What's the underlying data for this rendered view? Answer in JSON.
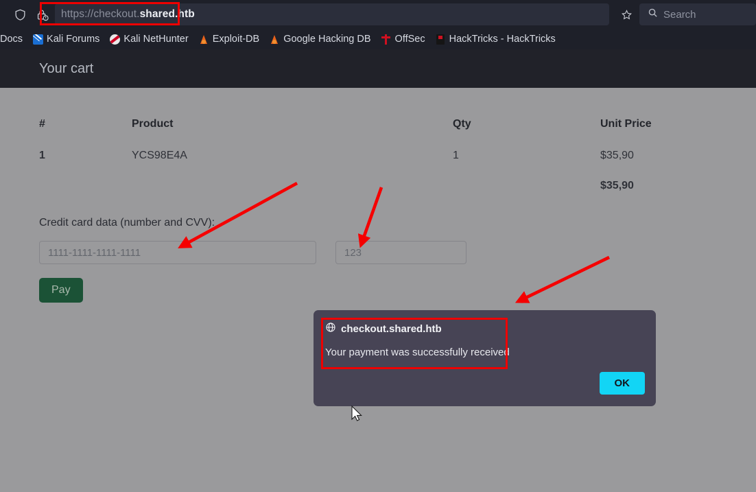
{
  "browser": {
    "url_prefix": "https://checkout.",
    "url_domain": "shared.htb",
    "shield_icon": "shield-icon",
    "lock_icon": "lock-warning-icon",
    "bookmark_star_icon": "star-icon",
    "search": {
      "placeholder": "Search",
      "icon": "search-icon"
    },
    "bookmarks": [
      {
        "label": "Docs",
        "icon": "none"
      },
      {
        "label": "Kali Forums",
        "icon": "kali-dragon-icon"
      },
      {
        "label": "Kali NetHunter",
        "icon": "nethunter-icon"
      },
      {
        "label": "Exploit-DB",
        "icon": "flame-icon"
      },
      {
        "label": "Google Hacking DB",
        "icon": "flame-icon"
      },
      {
        "label": "OffSec",
        "icon": "offsec-dagger-icon"
      },
      {
        "label": "HackTricks - HackTricks",
        "icon": "hacktricks-book-icon"
      }
    ]
  },
  "page": {
    "site_title": "Your cart",
    "table": {
      "headers": [
        "#",
        "Product",
        "Qty",
        "Unit Price"
      ],
      "rows": [
        {
          "index": "1",
          "product": "YCS98E4A",
          "qty": "1",
          "price": "$35,90"
        }
      ],
      "total": "$35,90"
    },
    "form": {
      "label": "Credit card data (number and CVV):",
      "card_number_placeholder": "1111-1111-1111-1111",
      "card_number_value": "",
      "cvv_placeholder": "123",
      "cvv_value": "",
      "pay_label": "Pay"
    }
  },
  "dialog": {
    "origin": "checkout.shared.htb",
    "globe_icon": "globe-icon",
    "message": "Your payment was successfully received",
    "ok_label": "OK"
  },
  "annotations": {
    "highlight_color": "#ee0000",
    "arrow_count": 3
  }
}
